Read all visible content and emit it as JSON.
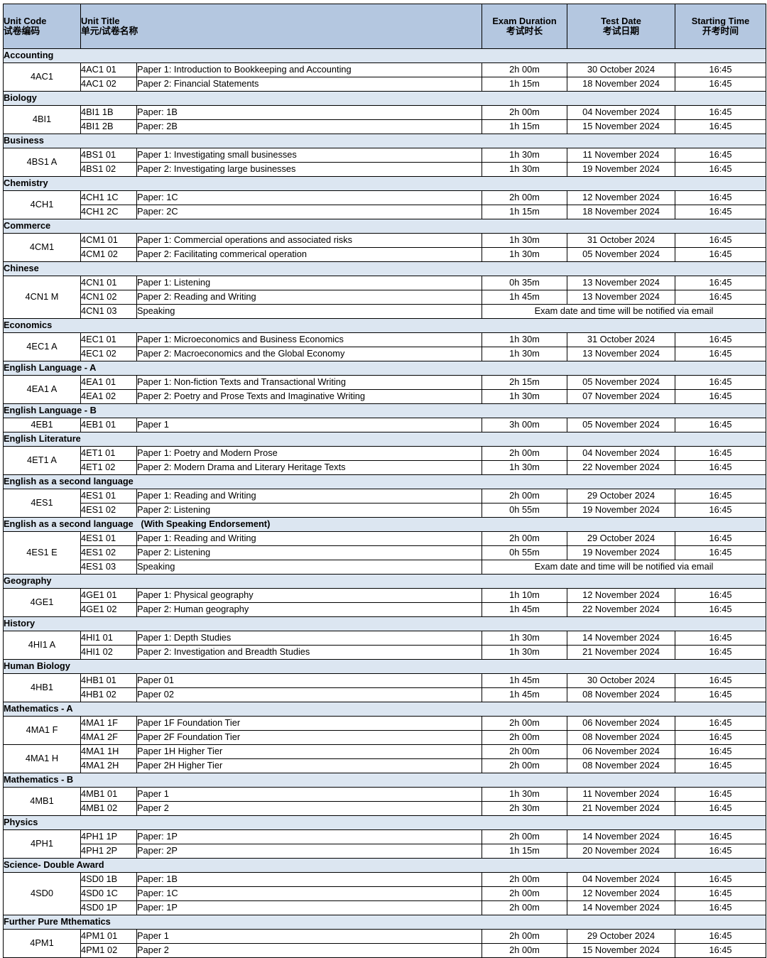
{
  "table": {
    "columns": [
      {
        "en": "Unit Code",
        "cn": "试卷编码",
        "key": "unit_code"
      },
      {
        "en": "Unit Title",
        "cn": "单元/试卷名称",
        "key": "unit_title"
      },
      {
        "en": "Exam Duration",
        "cn": "考试时长",
        "key": "duration"
      },
      {
        "en": "Test Date",
        "cn": "考试日期",
        "key": "date"
      },
      {
        "en": "Starting Time",
        "cn": "开考时间",
        "key": "time"
      }
    ],
    "note_text": "Exam date and time will be notified via email",
    "colors": {
      "header_bg": "#b4c7e0",
      "subject_bg": "#dce6f1",
      "note_bg": "#ffff00",
      "border": "#000000",
      "page_bg": "#ffffff"
    },
    "groups": [
      {
        "subject": "Accounting",
        "rows": [
          {
            "unit_code": "4AC1",
            "rowspan": 2,
            "paper_code": "4AC1 01",
            "title": "Paper 1: Introduction to Bookkeeping and Accounting",
            "duration": "2h 00m",
            "date": "30 October 2024",
            "time": "16:45"
          },
          {
            "paper_code": "4AC1 02",
            "title": "Paper 2: Financial Statements",
            "duration": "1h 15m",
            "date": "18 November 2024",
            "time": "16:45"
          }
        ]
      },
      {
        "subject": "Biology",
        "rows": [
          {
            "unit_code": "4BI1",
            "rowspan": 2,
            "paper_code": "4BI1 1B",
            "title": "Paper: 1B",
            "duration": "2h 00m",
            "date": "04 November 2024",
            "time": "16:45"
          },
          {
            "paper_code": "4BI1 2B",
            "title": "Paper: 2B",
            "duration": "1h 15m",
            "date": "15 November 2024",
            "time": "16:45"
          }
        ]
      },
      {
        "subject": "Business",
        "rows": [
          {
            "unit_code": "4BS1 A",
            "rowspan": 2,
            "paper_code": "4BS1 01",
            "title": "Paper 1: Investigating small businesses",
            "duration": "1h 30m",
            "date": "11 November 2024",
            "time": "16:45"
          },
          {
            "paper_code": "4BS1 02",
            "title": "Paper 2: Investigating large businesses",
            "duration": "1h 30m",
            "date": "19 November 2024",
            "time": "16:45"
          }
        ]
      },
      {
        "subject": "Chemistry",
        "rows": [
          {
            "unit_code": "4CH1",
            "rowspan": 2,
            "paper_code": "4CH1 1C",
            "title": "Paper: 1C",
            "duration": "2h 00m",
            "date": "12 November 2024",
            "time": "16:45"
          },
          {
            "paper_code": "4CH1 2C",
            "title": "Paper: 2C",
            "duration": "1h 15m",
            "date": "18 November 2024",
            "time": "16:45"
          }
        ]
      },
      {
        "subject": "Commerce",
        "rows": [
          {
            "unit_code": "4CM1",
            "rowspan": 2,
            "paper_code": "4CM1 01",
            "title": "Paper 1: Commercial operations and associated risks",
            "duration": "1h 30m",
            "date": "31 October 2024",
            "time": "16:45"
          },
          {
            "paper_code": "4CM1 02",
            "title": "Paper 2: Facilitating commerical operation",
            "duration": "1h 30m",
            "date": "05 November 2024",
            "time": "16:45"
          }
        ]
      },
      {
        "subject": "Chinese",
        "rows": [
          {
            "unit_code": "4CN1 M",
            "rowspan": 3,
            "paper_code": "4CN1 01",
            "title": "Paper 1: Listening",
            "duration": "0h 35m",
            "date": "13 November 2024",
            "time": "16:45"
          },
          {
            "paper_code": "4CN1 02",
            "title": "Paper 2: Reading and Writing",
            "duration": "1h 45m",
            "date": "13 November 2024",
            "time": "16:45"
          },
          {
            "paper_code": "4CN1 03",
            "title": "Speaking",
            "note": true
          }
        ]
      },
      {
        "subject": "Economics",
        "rows": [
          {
            "unit_code": "4EC1 A",
            "rowspan": 2,
            "paper_code": "4EC1 01",
            "title": "Paper 1: Microeconomics and Business Economics",
            "duration": "1h 30m",
            "date": "31 October 2024",
            "time": "16:45"
          },
          {
            "paper_code": "4EC1 02",
            "title": "Paper 2: Macroeconomics and the Global Economy",
            "duration": "1h 30m",
            "date": "13 November 2024",
            "time": "16:45"
          }
        ]
      },
      {
        "subject": "English Language - A",
        "rows": [
          {
            "unit_code": "4EA1 A",
            "rowspan": 2,
            "paper_code": "4EA1 01",
            "title": "Paper 1: Non-fiction Texts and Transactional Writing",
            "duration": "2h 15m",
            "date": "05 November 2024",
            "time": "16:45"
          },
          {
            "paper_code": "4EA1 02",
            "title": "Paper 2: Poetry and Prose Texts and Imaginative Writing",
            "duration": "1h 30m",
            "date": "07 November 2024",
            "time": "16:45"
          }
        ]
      },
      {
        "subject": "English Language - B",
        "rows": [
          {
            "unit_code": "4EB1",
            "rowspan": 1,
            "paper_code": "4EB1 01",
            "title": "Paper 1",
            "duration": "3h 00m",
            "date": "05 November 2024",
            "time": "16:45"
          }
        ]
      },
      {
        "subject": "English Literature",
        "rows": [
          {
            "unit_code": "4ET1 A",
            "rowspan": 2,
            "paper_code": "4ET1 01",
            "title": "Paper 1: Poetry and Modern Prose",
            "duration": "2h 00m",
            "date": "04 November 2024",
            "time": "16:45"
          },
          {
            "paper_code": "4ET1 02",
            "title": "Paper 2: Modern Drama and Literary Heritage Texts",
            "duration": "1h 30m",
            "date": "22 November 2024",
            "time": "16:45"
          }
        ]
      },
      {
        "subject": "English as a second language",
        "rows": [
          {
            "unit_code": "4ES1",
            "rowspan": 2,
            "paper_code": "4ES1 01",
            "title": "Paper 1: Reading and Writing",
            "duration": "2h 00m",
            "date": "29 October 2024",
            "time": "16:45"
          },
          {
            "paper_code": "4ES1 02",
            "title": "Paper 2: Listening",
            "duration": "0h 55m",
            "date": "19 November 2024",
            "time": "16:45"
          }
        ]
      },
      {
        "subject": "English as a second language   (With Speaking Endorsement)",
        "rows": [
          {
            "unit_code": "4ES1 E",
            "rowspan": 3,
            "paper_code": "4ES1 01",
            "title": "Paper 1: Reading and Writing",
            "duration": "2h 00m",
            "date": "29 October 2024",
            "time": "16:45"
          },
          {
            "paper_code": "4ES1 02",
            "title": "Paper 2: Listening",
            "duration": "0h 55m",
            "date": "19 November 2024",
            "time": "16:45"
          },
          {
            "paper_code": "4ES1 03",
            "title": "Speaking",
            "note": true
          }
        ]
      },
      {
        "subject": "Geography",
        "rows": [
          {
            "unit_code": "4GE1",
            "rowspan": 2,
            "paper_code": "4GE1 01",
            "title": "Paper 1: Physical geography",
            "duration": "1h 10m",
            "date": "12 November 2024",
            "time": "16:45"
          },
          {
            "paper_code": "4GE1 02",
            "title": "Paper 2: Human geography",
            "duration": "1h 45m",
            "date": "22 November 2024",
            "time": "16:45"
          }
        ]
      },
      {
        "subject": "History",
        "rows": [
          {
            "unit_code": "4HI1 A",
            "rowspan": 2,
            "paper_code": "4HI1 01",
            "title": "Paper 1: Depth Studies",
            "duration": "1h 30m",
            "date": "14 November 2024",
            "time": "16:45"
          },
          {
            "paper_code": "4HI1 02",
            "title": "Paper 2: Investigation and Breadth Studies",
            "duration": "1h 30m",
            "date": "21 November 2024",
            "time": "16:45"
          }
        ]
      },
      {
        "subject": "Human Biology",
        "rows": [
          {
            "unit_code": "4HB1",
            "rowspan": 2,
            "paper_code": "4HB1 01",
            "title": "Paper 01",
            "duration": "1h 45m",
            "date": "30 October 2024",
            "time": "16:45"
          },
          {
            "paper_code": "4HB1 02",
            "title": "Paper 02",
            "duration": "1h 45m",
            "date": "08 November 2024",
            "time": "16:45"
          }
        ]
      },
      {
        "subject": "Mathematics - A",
        "rows": [
          {
            "unit_code": "4MA1 F",
            "rowspan": 2,
            "paper_code": "4MA1 1F",
            "title": "Paper 1F Foundation Tier",
            "duration": "2h 00m",
            "date": "06 November 2024",
            "time": "16:45"
          },
          {
            "paper_code": "4MA1 2F",
            "title": "Paper 2F Foundation Tier",
            "duration": "2h 00m",
            "date": "08 November 2024",
            "time": "16:45"
          },
          {
            "unit_code": "4MA1 H",
            "rowspan": 2,
            "paper_code": "4MA1 1H",
            "title": "Paper 1H Higher Tier",
            "duration": "2h 00m",
            "date": "06 November 2024",
            "time": "16:45"
          },
          {
            "paper_code": "4MA1 2H",
            "title": "Paper 2H Higher Tier",
            "duration": "2h 00m",
            "date": "08 November 2024",
            "time": "16:45"
          }
        ]
      },
      {
        "subject": "Mathematics - B",
        "rows": [
          {
            "unit_code": "4MB1",
            "rowspan": 2,
            "paper_code": "4MB1 01",
            "title": "Paper 1",
            "duration": "1h 30m",
            "date": "11 November 2024",
            "time": "16:45"
          },
          {
            "paper_code": "4MB1 02",
            "title": "Paper 2",
            "duration": "2h 30m",
            "date": "21 November 2024",
            "time": "16:45"
          }
        ]
      },
      {
        "subject": "Physics",
        "rows": [
          {
            "unit_code": "4PH1",
            "rowspan": 2,
            "paper_code": "4PH1 1P",
            "title": "Paper: 1P",
            "duration": "2h 00m",
            "date": "14 November 2024",
            "time": "16:45"
          },
          {
            "paper_code": "4PH1 2P",
            "title": "Paper: 2P",
            "duration": "1h 15m",
            "date": "20 November 2024",
            "time": "16:45"
          }
        ]
      },
      {
        "subject": "Science- Double Award",
        "rows": [
          {
            "unit_code": "4SD0",
            "rowspan": 3,
            "paper_code": "4SD0 1B",
            "title": "Paper: 1B",
            "duration": "2h 00m",
            "date": "04 November 2024",
            "time": "16:45"
          },
          {
            "paper_code": "4SD0 1C",
            "title": "Paper: 1C",
            "duration": "2h 00m",
            "date": "12 November 2024",
            "time": "16:45"
          },
          {
            "paper_code": "4SD0 1P",
            "title": "Paper: 1P",
            "duration": "2h 00m",
            "date": "14 November 2024",
            "time": "16:45"
          }
        ]
      },
      {
        "subject": "Further Pure Mthematics",
        "rows": [
          {
            "unit_code": "4PM1",
            "rowspan": 2,
            "paper_code": "4PM1 01",
            "title": "Paper 1",
            "duration": "2h 00m",
            "date": "29 October 2024",
            "time": "16:45"
          },
          {
            "paper_code": "4PM1 02",
            "title": "Paper 2",
            "duration": "2h 00m",
            "date": "15 November 2024",
            "time": "16:45"
          }
        ]
      }
    ]
  }
}
